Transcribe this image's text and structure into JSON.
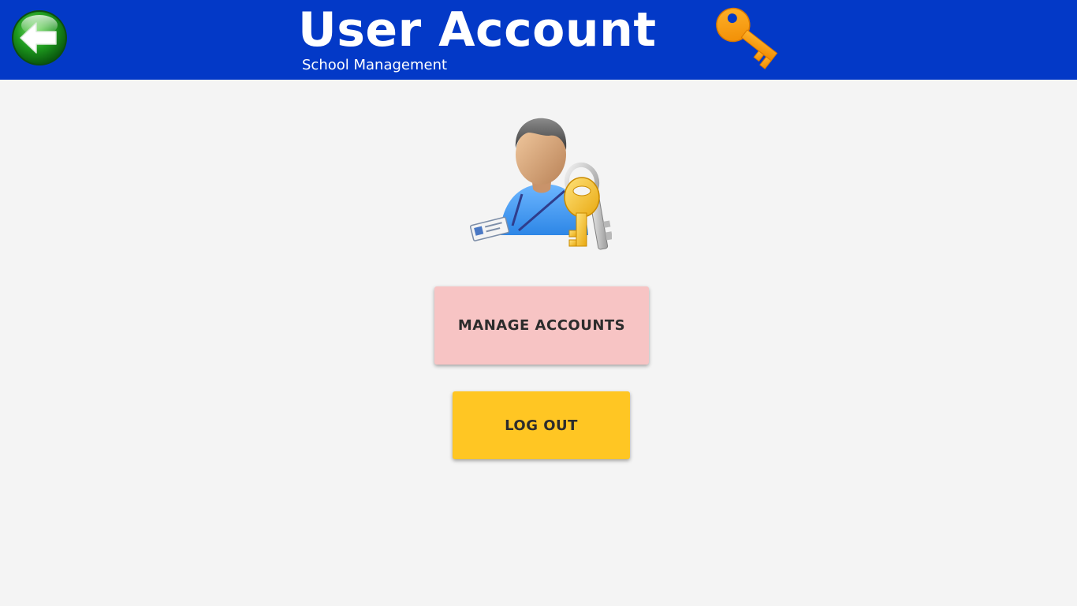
{
  "header": {
    "title": "User Account",
    "subtitle": "School Management",
    "back_icon": "back-arrow-icon",
    "key_icon": "key-icon"
  },
  "main": {
    "illustration_icon": "user-with-keys-icon",
    "buttons": [
      {
        "label": "MANAGE ACCOUNTS",
        "color": "#f7c4c4"
      },
      {
        "label": "LOG OUT",
        "color": "#ffc623"
      }
    ]
  },
  "colors": {
    "header_bg": "#0339c7",
    "page_bg": "#f4f4f4",
    "header_text": "#ffffff",
    "button_text": "#2c2c2c"
  }
}
